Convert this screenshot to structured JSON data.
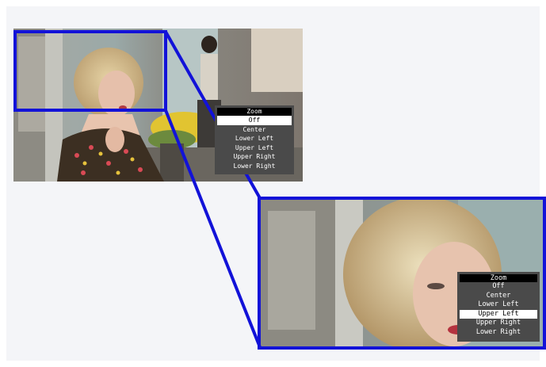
{
  "menu": {
    "title": "Zoom",
    "options": [
      "Off",
      "Center",
      "Lower Left",
      "Upper Left",
      "Upper Right",
      "Lower Right"
    ]
  },
  "small_view": {
    "selected_option": "Off"
  },
  "large_view": {
    "selected_option": "Upper Left"
  },
  "colors": {
    "highlight_frame": "#1212d8",
    "menu_background": "#4a4a4a",
    "menu_title_background": "#000000",
    "menu_selected_background": "#ffffff"
  }
}
